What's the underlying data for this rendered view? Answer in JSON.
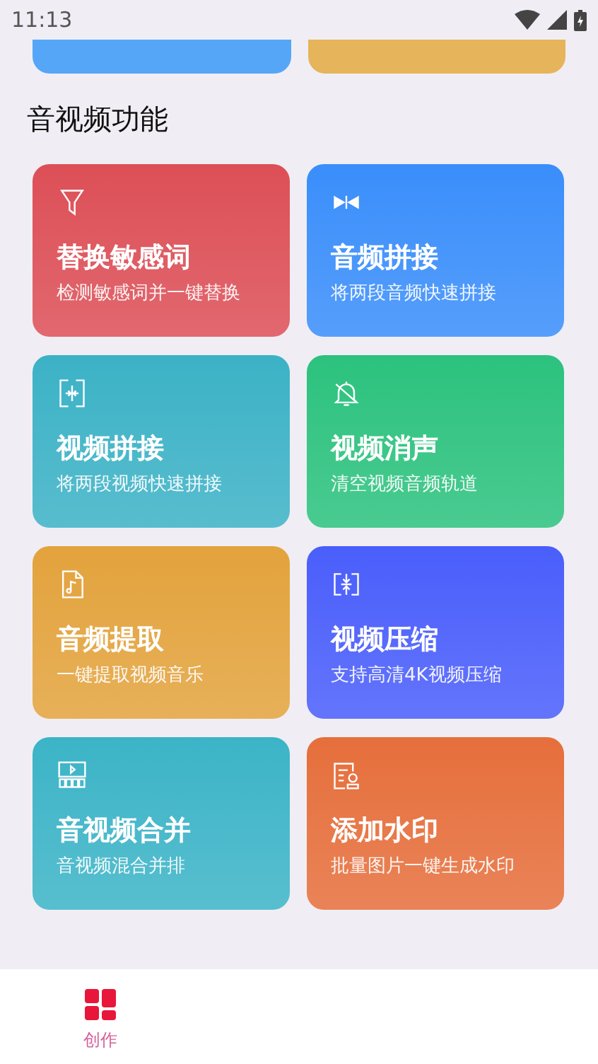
{
  "status_bar": {
    "time": "11:13"
  },
  "top_cards": [
    {
      "color": "#56a6f8"
    },
    {
      "color": "#e6b45a"
    }
  ],
  "section": {
    "title": "音视频功能"
  },
  "features": [
    {
      "kind": "filter",
      "title": "替换敏感词",
      "subtitle": "检测敏感词并一键替换",
      "color": "#dd4f57"
    },
    {
      "kind": "audio-join",
      "title": "音频拼接",
      "subtitle": "将两段音频快速拼接",
      "color": "#3a8efb"
    },
    {
      "kind": "video-join",
      "title": "视频拼接",
      "subtitle": "将两段视频快速拼接",
      "color": "#3cb2c6"
    },
    {
      "kind": "mute",
      "title": "视频消声",
      "subtitle": "清空视频音频轨道",
      "color": "#2cc27e"
    },
    {
      "kind": "music-file",
      "title": "音频提取",
      "subtitle": "一键提取视频音乐",
      "color": "#e3a33d"
    },
    {
      "kind": "compress",
      "title": "视频压缩",
      "subtitle": "支持高清4K视频压缩",
      "color": "#4a5efb"
    },
    {
      "kind": "merge",
      "title": "音视频合并",
      "subtitle": "音视频混合并排",
      "color": "#3cb4c7"
    },
    {
      "kind": "watermark",
      "title": "添加水印",
      "subtitle": "批量图片一键生成水印",
      "color": "#e66f3c"
    }
  ],
  "bottom_nav": [
    {
      "label": "创作",
      "selected": true
    }
  ]
}
